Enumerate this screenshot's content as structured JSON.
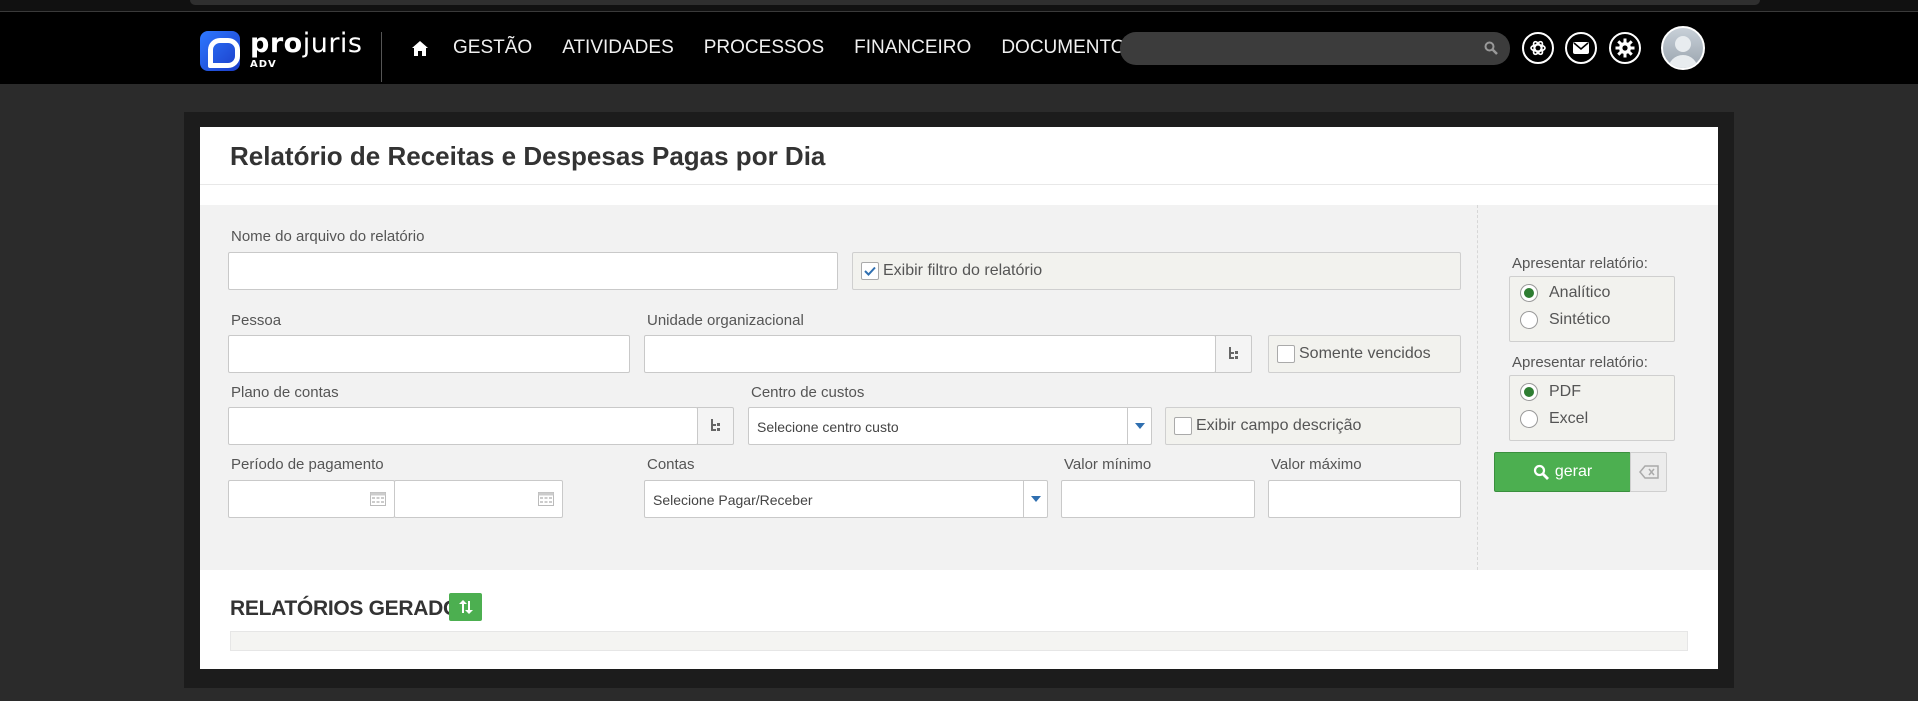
{
  "header": {
    "logo": {
      "name_bold": "pro",
      "name_light": "juris",
      "sub": "ADV"
    },
    "nav": [
      "GESTÃO",
      "ATIVIDADES",
      "PROCESSOS",
      "FINANCEIRO",
      "DOCUMENTOS"
    ],
    "search_value": ""
  },
  "page": {
    "title": "Relatório de Receitas e Despesas Pagas por Dia"
  },
  "form": {
    "nome_arquivo_label": "Nome do arquivo do relatório",
    "nome_arquivo_value": "",
    "exibir_filtro_label": "Exibir filtro do relatório",
    "exibir_filtro_checked": true,
    "pessoa_label": "Pessoa",
    "pessoa_value": "",
    "unidade_label": "Unidade organizacional",
    "unidade_value": "",
    "somente_vencidos_label": "Somente vencidos",
    "somente_vencidos_checked": false,
    "plano_contas_label": "Plano de contas",
    "plano_contas_value": "",
    "centro_custos_label": "Centro de custos",
    "centro_custos_value": "Selecione centro custo",
    "exibir_descricao_label": "Exibir campo descrição",
    "exibir_descricao_checked": false,
    "periodo_label": "Período de pagamento",
    "periodo_inicio": "",
    "periodo_fim": "",
    "contas_label": "Contas",
    "contas_value": "Selecione Pagar/Receber",
    "valor_minimo_label": "Valor mínimo",
    "valor_minimo_value": "",
    "valor_maximo_label": "Valor máximo",
    "valor_maximo_value": ""
  },
  "options": {
    "tipo_label": "Apresentar relatório:",
    "tipo": [
      {
        "label": "Analítico",
        "selected": true
      },
      {
        "label": "Sintético",
        "selected": false
      }
    ],
    "formato_label": "Apresentar relatório:",
    "formato": [
      {
        "label": "PDF",
        "selected": true
      },
      {
        "label": "Excel",
        "selected": false
      }
    ],
    "gerar_label": "gerar"
  },
  "gerados": {
    "title": "RELATÓRIOS GERADOS"
  },
  "colors": {
    "accent_green": "#4caf50",
    "header_bg": "#000000",
    "brand_blue": "#2e78ff"
  }
}
